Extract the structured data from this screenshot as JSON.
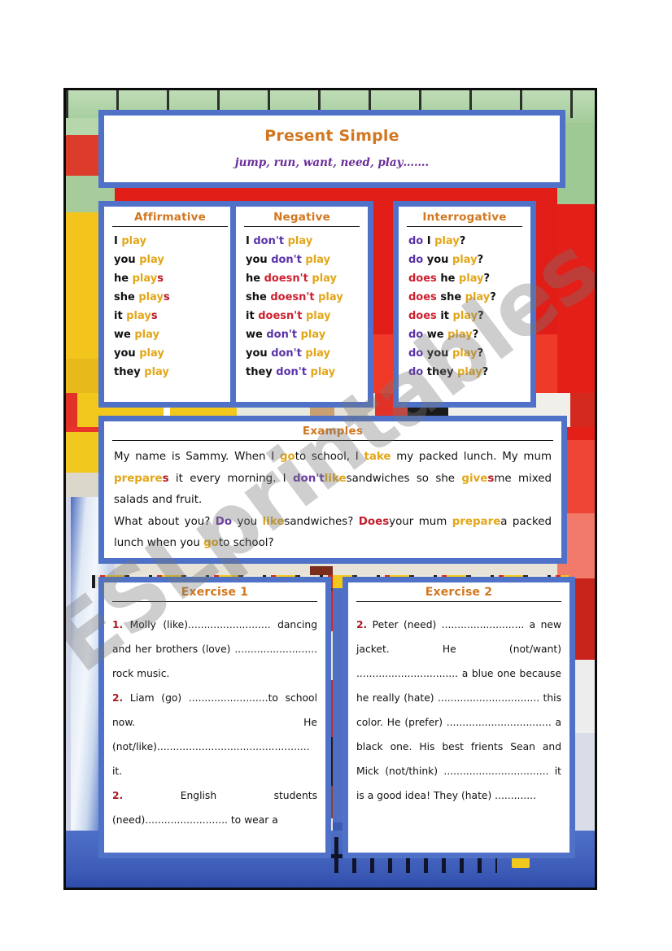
{
  "sheet": {
    "watermark": "ESLprintables.com",
    "accent_border": "#4f72c8",
    "title_color": "#d2771f"
  },
  "title_card": {
    "title": "Present Simple",
    "subtitle": "jump, run, want, need, play…….",
    "subtitle_color": "#6a2f9a"
  },
  "tables": {
    "affirmative": {
      "heading": "Affirmative",
      "rows": [
        {
          "pronoun": "I",
          "verb": "play",
          "suffix": ""
        },
        {
          "pronoun": "you",
          "verb": "play",
          "suffix": ""
        },
        {
          "pronoun": "he",
          "verb": "play",
          "suffix": "s"
        },
        {
          "pronoun": "she",
          "verb": "play",
          "suffix": "s"
        },
        {
          "pronoun": "it",
          "verb": "play",
          "suffix": "s"
        },
        {
          "pronoun": "we",
          "verb": "play",
          "suffix": ""
        },
        {
          "pronoun": "you",
          "verb": "play",
          "suffix": ""
        },
        {
          "pronoun": "they",
          "verb": "play",
          "suffix": ""
        }
      ]
    },
    "negative": {
      "heading": "Negative",
      "rows": [
        {
          "pronoun": "I",
          "aux": "don't",
          "aux_type": "dont",
          "verb": "play"
        },
        {
          "pronoun": "you",
          "aux": "don't",
          "aux_type": "dont",
          "verb": "play"
        },
        {
          "pronoun": "he",
          "aux": "doesn't",
          "aux_type": "doesnt",
          "verb": "play"
        },
        {
          "pronoun": "she",
          "aux": "doesn't",
          "aux_type": "doesnt",
          "verb": "play"
        },
        {
          "pronoun": "it",
          "aux": "doesn't",
          "aux_type": "doesnt",
          "verb": "play"
        },
        {
          "pronoun": "we",
          "aux": "don't",
          "aux_type": "dont",
          "verb": "play"
        },
        {
          "pronoun": "you",
          "aux": "don't",
          "aux_type": "dont",
          "verb": "play"
        },
        {
          "pronoun": "they",
          "aux": "don't",
          "aux_type": "dont",
          "verb": "play"
        }
      ]
    },
    "interrogative": {
      "heading": "Interrogative",
      "rows": [
        {
          "aux": "do",
          "aux_type": "do",
          "pronoun": "I",
          "verb": "play",
          "mark": "?"
        },
        {
          "aux": "do",
          "aux_type": "do",
          "pronoun": "you",
          "verb": "play",
          "mark": "?"
        },
        {
          "aux": "does",
          "aux_type": "does",
          "pronoun": "he",
          "verb": "play",
          "mark": "?"
        },
        {
          "aux": "does",
          "aux_type": "does",
          "pronoun": "she",
          "verb": "play",
          "mark": "?"
        },
        {
          "aux": "does",
          "aux_type": "does",
          "pronoun": "it",
          "verb": "play",
          "mark": "?"
        },
        {
          "aux": "do",
          "aux_type": "do",
          "pronoun": "we",
          "verb": "play",
          "mark": "?"
        },
        {
          "aux": "do",
          "aux_type": "do",
          "pronoun": "you",
          "verb": "play",
          "mark": "?"
        },
        {
          "aux": "do",
          "aux_type": "do",
          "pronoun": "they",
          "verb": "play",
          "mark": "?"
        }
      ]
    }
  },
  "examples": {
    "heading": "Examples",
    "paragraph1": [
      {
        "text": "My name is Sammy. When I ",
        "style": "plain"
      },
      {
        "text": "go",
        "style": "verb"
      },
      {
        "text": "to school, I ",
        "style": "plain"
      },
      {
        "text": "take",
        "style": "verb"
      },
      {
        "text": " my packed lunch. My mum ",
        "style": "plain"
      },
      {
        "text": "prepare",
        "style": "verb"
      },
      {
        "text": "s",
        "style": "s"
      },
      {
        "text": " it every morning. I ",
        "style": "plain"
      },
      {
        "text": "don't",
        "style": "dont"
      },
      {
        "text": "like",
        "style": "verb"
      },
      {
        "text": "sandwiches so she ",
        "style": "plain"
      },
      {
        "text": "give",
        "style": "verb"
      },
      {
        "text": "s",
        "style": "s"
      },
      {
        "text": "me mixed salads and fruit.",
        "style": "plain"
      }
    ],
    "paragraph2": [
      {
        "text": "What about you? ",
        "style": "plain"
      },
      {
        "text": "Do",
        "style": "do"
      },
      {
        "text": " you ",
        "style": "plain"
      },
      {
        "text": "like",
        "style": "verb"
      },
      {
        "text": "sandwiches? ",
        "style": "plain"
      },
      {
        "text": "Does",
        "style": "does"
      },
      {
        "text": "your mum ",
        "style": "plain"
      },
      {
        "text": "prepare",
        "style": "verb"
      },
      {
        "text": "a packed lunch when you ",
        "style": "plain"
      },
      {
        "text": "go",
        "style": "verb"
      },
      {
        "text": "to school?",
        "style": "plain"
      }
    ]
  },
  "exercise1": {
    "heading": "Exercise 1",
    "items": [
      {
        "num": "1.",
        "text": "  Molly      (like).......................... dancing  and  her  brothers  (love) .......................... rock music."
      },
      {
        "num": "2.",
        "text": " Liam (go) .........................to school now.                            He (not/like)................................................ it."
      },
      {
        "num": "2.",
        "text": "        English       students (need)..........................  to   wear   a"
      }
    ]
  },
  "exercise2": {
    "heading": "Exercise 2",
    "items": [
      {
        "num": "2.",
        "text": " Peter  (need)  ..........................  a new    jacket.    He    (not/want) ................................  a   blue   one because    he    really    (hate) ................................  this  color.  He (prefer)  .................................  a  black one. His best frients Sean and Mick (not/think) ................................. it is a good   idea!   They   (hate)   ............."
      }
    ]
  }
}
